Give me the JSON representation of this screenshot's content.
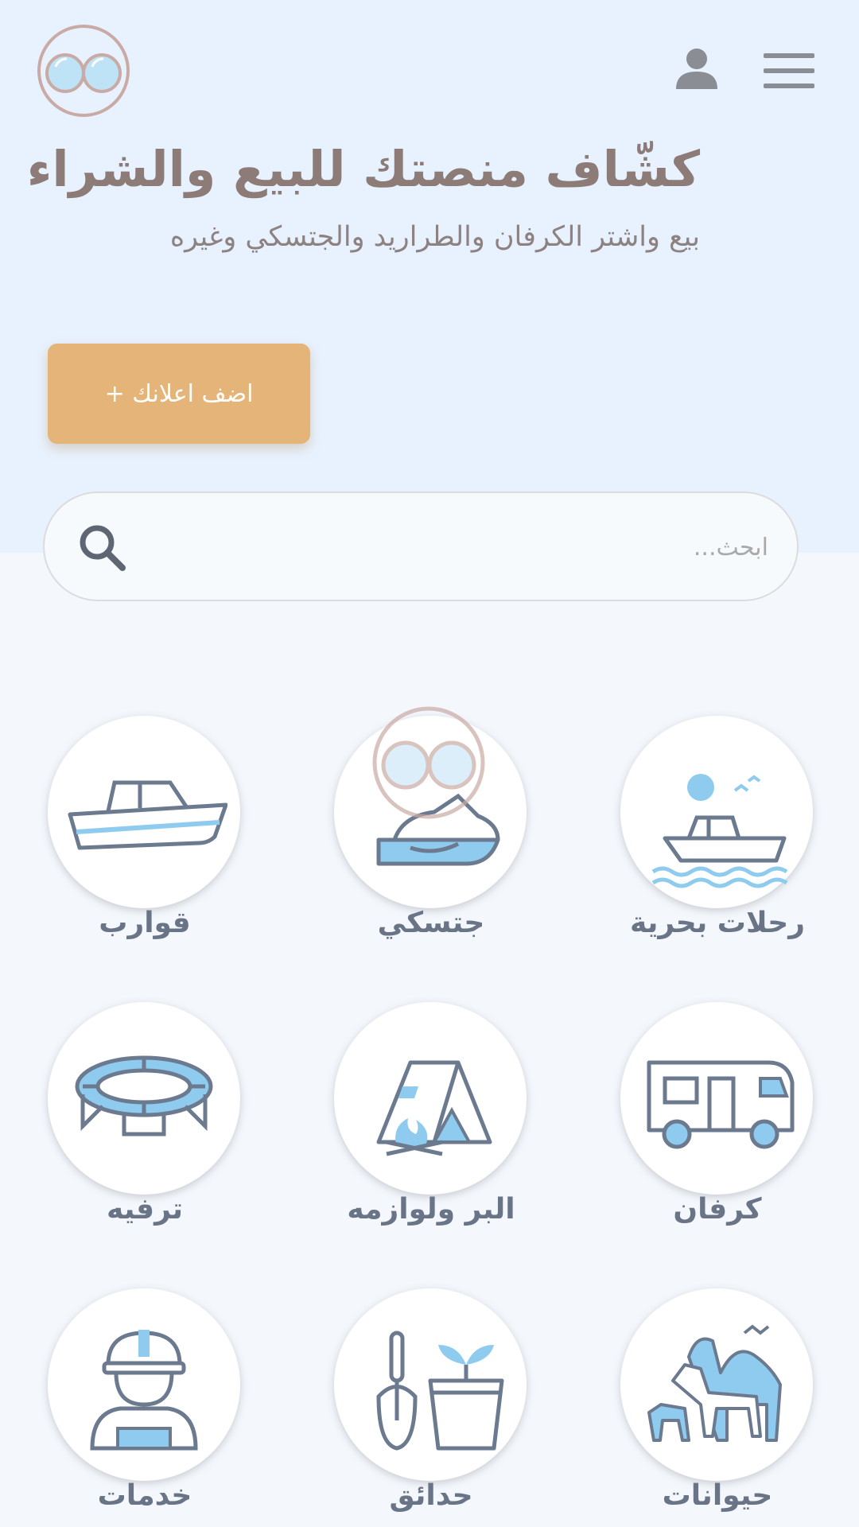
{
  "header": {
    "logo_icon": "binoculars-logo-icon",
    "user_icon": "user-icon",
    "menu_icon": "hamburger-menu-icon"
  },
  "hero": {
    "title": "كشّاف منصتك للبيع والشراء",
    "subtitle": "بيع واشتر الكرفان والطراريد والجتسكي وغيره",
    "add_button_label": "اضف اعلانك +"
  },
  "search": {
    "placeholder": "ابحث...",
    "icon": "search-icon"
  },
  "categories": [
    {
      "label": "رحلات بحرية",
      "icon": "sea-trip-icon"
    },
    {
      "label": "جتسكي",
      "icon": "jetski-icon"
    },
    {
      "label": "قوارب",
      "icon": "boat-icon"
    },
    {
      "label": "كرفان",
      "icon": "caravan-icon"
    },
    {
      "label": "البر ولوازمه",
      "icon": "camping-tent-icon"
    },
    {
      "label": "ترفيه",
      "icon": "trampoline-icon"
    },
    {
      "label": "حيوانات",
      "icon": "animals-icon"
    },
    {
      "label": "حدائق",
      "icon": "gardening-icon"
    },
    {
      "label": "خدمات",
      "icon": "worker-icon"
    }
  ],
  "colors": {
    "hero_bg": "#e8f2fe",
    "page_bg": "#f4f8fd",
    "accent": "#e5b478",
    "icon_stroke": "#6b7a8f",
    "icon_fill": "#8ecbef",
    "title": "#8d7b78"
  }
}
